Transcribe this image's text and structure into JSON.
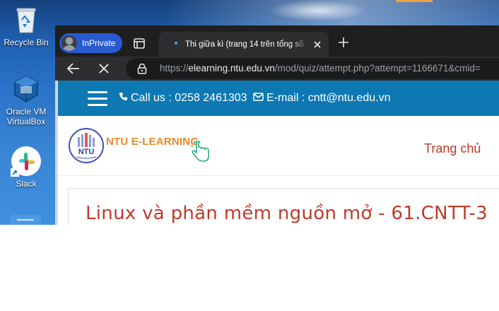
{
  "desktop": {
    "icons": [
      {
        "label": "Recycle Bin",
        "icon": "recycle-bin-icon"
      },
      {
        "label": "Oracle VM\nVirtualBox",
        "line1": "Oracle VM",
        "line2": "VirtualBox",
        "icon": "virtualbox-icon"
      },
      {
        "label": "Slack",
        "icon": "slack-icon"
      }
    ]
  },
  "browser": {
    "profile_label": "InPrivate",
    "tab_title": "Thi giữa kì (trang 14 trên tổng số",
    "url_prefix": "https://",
    "url_host": "elearning.ntu.edu.vn",
    "url_path": "/mod/quiz/attempt.php?attempt=1166671&cmid=",
    "accent": "#2a5ad0"
  },
  "site": {
    "contact_phone": "Call us : 0258 2461303",
    "contact_email": "E-mail : cntt@ntu.edu.vn",
    "brand": "NTU E-LEARNING",
    "logo_text": "NTU",
    "nav_home": "Trang chủ",
    "quiz_title": "Linux và phần mềm nguồn mở - 61.CNTT-3",
    "topbar_color": "#0e78b3",
    "title_color": "#c0392b",
    "brand_color": "#e6892a"
  }
}
